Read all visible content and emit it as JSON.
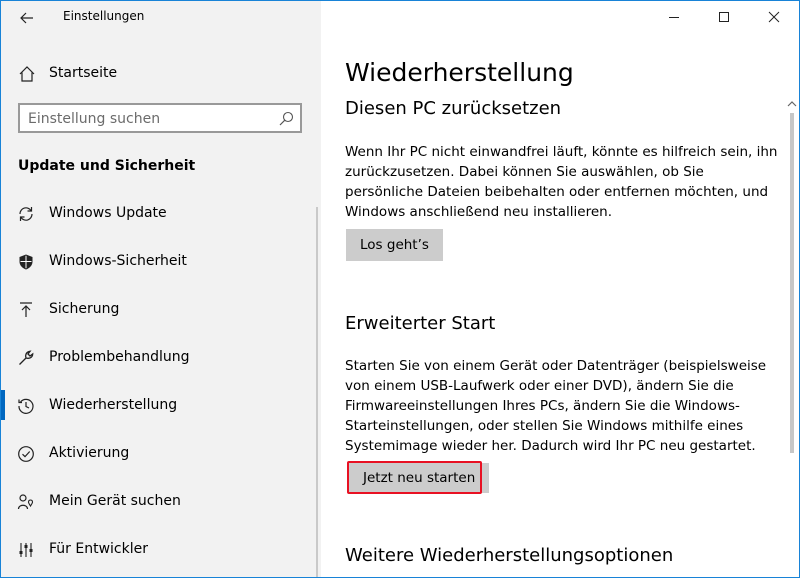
{
  "app_title": "Einstellungen",
  "sidebar": {
    "home_label": "Startseite",
    "search_placeholder": "Einstellung suchen",
    "section_title": "Update und Sicherheit",
    "items": [
      {
        "label": "Windows Update",
        "icon": "sync-icon"
      },
      {
        "label": "Windows-Sicherheit",
        "icon": "shield-icon"
      },
      {
        "label": "Sicherung",
        "icon": "upload-arrow-icon"
      },
      {
        "label": "Problembehandlung",
        "icon": "wrench-icon"
      },
      {
        "label": "Wiederherstellung",
        "icon": "history-icon",
        "active": true
      },
      {
        "label": "Aktivierung",
        "icon": "check-circle-icon"
      },
      {
        "label": "Mein Gerät suchen",
        "icon": "person-location-icon"
      },
      {
        "label": "Für Entwickler",
        "icon": "developer-sliders-icon"
      }
    ]
  },
  "main": {
    "title": "Wiederherstellung",
    "reset": {
      "heading": "Diesen PC zurücksetzen",
      "description": "Wenn Ihr PC nicht einwandfrei läuft, könnte es hilfreich sein, ihn zurückzusetzen. Dabei können Sie auswählen, ob Sie persönliche Dateien beibehalten oder entfernen möchten, und Windows anschließend neu installieren.",
      "button": "Los geht’s"
    },
    "advanced": {
      "heading": "Erweiterter Start",
      "description": "Starten Sie von einem Gerät oder Datenträger (beispielsweise von einem USB-Laufwerk oder einer DVD), ändern Sie die Firmwareeinstellungen Ihres PCs, ändern Sie die Windows-Starteinstellungen, oder stellen Sie Windows mithilfe eines Systemimage wieder her. Dadurch wird Ihr PC neu gestartet.",
      "button": "Jetzt neu starten"
    },
    "more_heading": "Weitere Wiederherstellungsoptionen"
  },
  "colors": {
    "accent": "#0067c0",
    "highlight": "#e81123",
    "sidebar_bg": "#f2f2f2",
    "button_bg": "#cccccc"
  }
}
